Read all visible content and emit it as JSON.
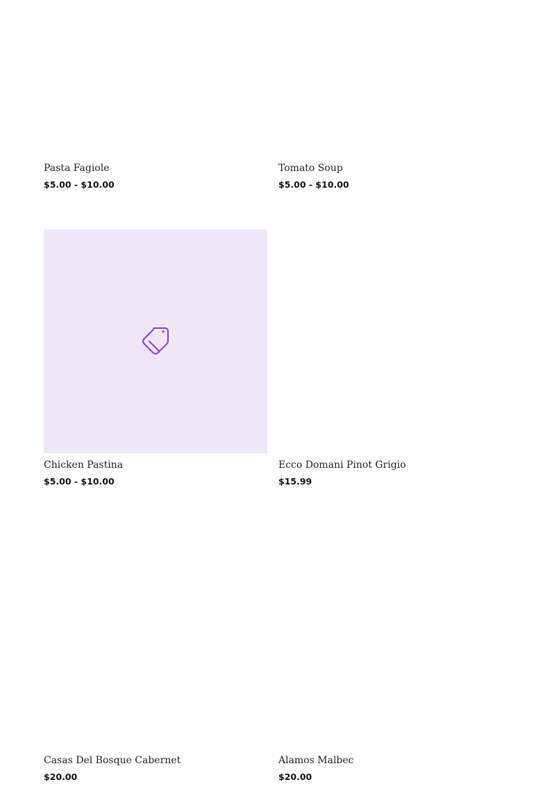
{
  "products": [
    {
      "name": "Pasta Fagiole",
      "price": "$5.00 - $10.00"
    },
    {
      "name": "Tomato Soup",
      "price": "$5.00 - $10.00"
    },
    {
      "name": "Chicken Pastina",
      "price": "$5.00 - $10.00",
      "image": "tag-icon"
    },
    {
      "name": "Ecco Domani Pinot Grigio",
      "price": "$15.99"
    },
    {
      "name": "Casas Del Bosque Cabernet",
      "price": "$20.00"
    },
    {
      "name": "Alamos Malbec",
      "price": "$20.00"
    }
  ],
  "colors": {
    "placeholder_bg": "#efe7f8",
    "icon_stroke": "#8a3fc4"
  }
}
